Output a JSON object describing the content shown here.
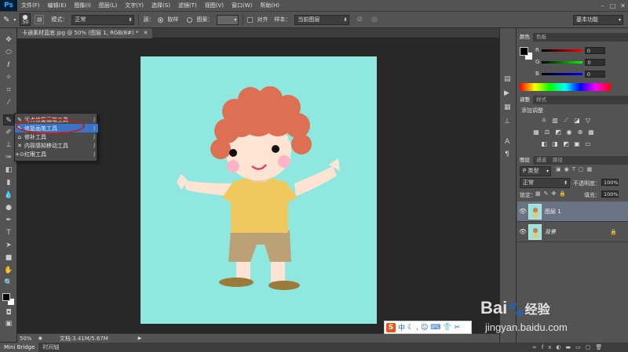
{
  "app": {
    "logo": "Ps",
    "workspace": "基本功能"
  },
  "menu": [
    "文件(F)",
    "编辑(E)",
    "图像(I)",
    "图层(L)",
    "文字(Y)",
    "选择(S)",
    "滤镜(T)",
    "视图(V)",
    "窗口(W)",
    "帮助(H)"
  ],
  "options": {
    "brush_size": "50",
    "mode_label": "模式：",
    "mode_value": "正常",
    "source_label": "源：",
    "source_sampled": "取样",
    "source_pattern": "图案：",
    "aligned_label": "对齐",
    "sample_label": "样本：",
    "sample_value": "当前图层"
  },
  "document": {
    "tab_title": "卡通素材蓝底.jpg @ 50% (图层 1, RGB/8#) *",
    "zoom": "50%",
    "doc_info": "文档:3.41M/5.67M"
  },
  "flyout": {
    "items": [
      {
        "label": "污点修复画笔工具",
        "key": "J"
      },
      {
        "label": "修复画笔工具",
        "key": "J"
      },
      {
        "label": "修补工具",
        "key": "J"
      },
      {
        "label": "内容感知移动工具",
        "key": "J"
      },
      {
        "label": "红眼工具",
        "key": "J"
      }
    ]
  },
  "color_panel": {
    "tabs": [
      "颜色",
      "色板"
    ],
    "r_label": "R",
    "r_value": "0",
    "g_label": "G",
    "g_value": "0",
    "b_label": "B",
    "b_value": "0"
  },
  "adjust_panel": {
    "tabs": [
      "调整",
      "样式"
    ],
    "title": "添加调整"
  },
  "layers_panel": {
    "tabs": [
      "图层",
      "通道",
      "路径"
    ],
    "filter_label": "P 类型",
    "blend_mode": "正常",
    "opacity_label": "不透明度：",
    "opacity_value": "100%",
    "lock_label": "锁定：",
    "fill_label": "填充：",
    "fill_value": "100%",
    "layers": [
      {
        "name": "图层 1",
        "selected": true
      },
      {
        "name": "背景",
        "selected": false
      }
    ]
  },
  "bottom_tabs": [
    "Mini Bridge",
    "时间轴"
  ],
  "watermark": {
    "brand": "Bai",
    "brand2": "经验",
    "url": "jingyan.baidu.com"
  },
  "ime": {
    "logo": "S",
    "lang": "中"
  },
  "colors": {
    "canvas_bg": "#8ee8df",
    "hair": "#dd6f52",
    "shirt": "#efc95e",
    "shorts": "#bca177",
    "skin": "#ffe4d4",
    "highlight": "#c0201c"
  }
}
